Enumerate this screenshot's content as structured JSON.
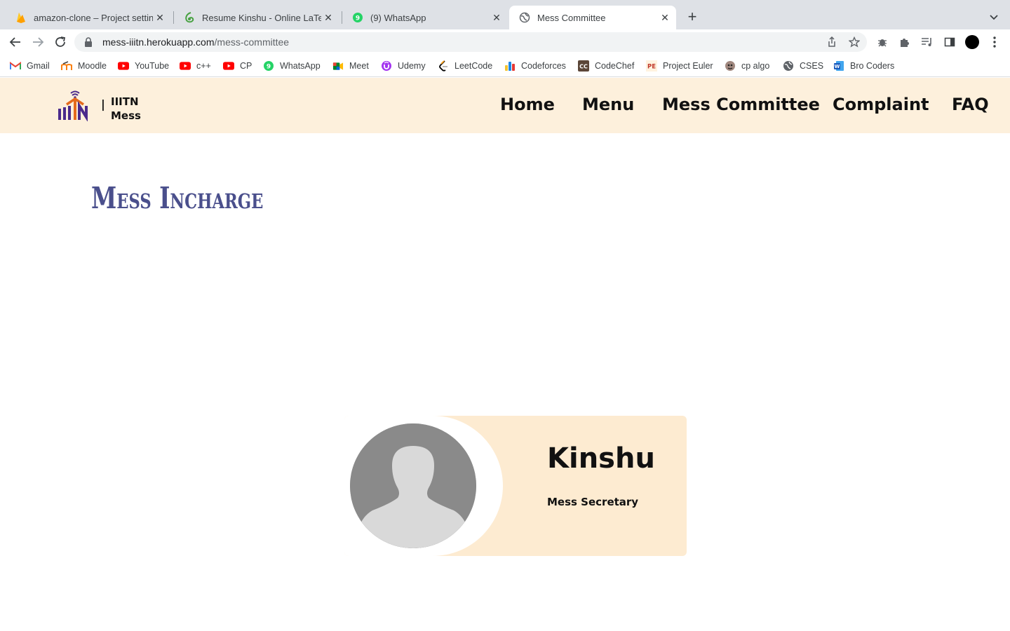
{
  "browser": {
    "tabs": [
      {
        "title": "amazon-clone – Project setting",
        "icon": "firebase-icon"
      },
      {
        "title": "Resume Kinshu - Online LaTeX",
        "icon": "overleaf-icon"
      },
      {
        "title": "(9) WhatsApp",
        "icon": "whatsapp-icon"
      },
      {
        "title": "Mess Committee",
        "icon": "globe-icon"
      }
    ],
    "url_host": "mess-iiitn.herokuapp.com",
    "url_path": "/mess-committee",
    "bookmarks": [
      {
        "label": "Gmail",
        "icon": "gmail-icon"
      },
      {
        "label": "Moodle",
        "icon": "moodle-icon"
      },
      {
        "label": "YouTube",
        "icon": "youtube-icon"
      },
      {
        "label": "c++",
        "icon": "youtube-icon"
      },
      {
        "label": "CP",
        "icon": "youtube-icon"
      },
      {
        "label": "WhatsApp",
        "icon": "whatsapp-icon"
      },
      {
        "label": "Meet",
        "icon": "meet-icon"
      },
      {
        "label": "Udemy",
        "icon": "udemy-icon"
      },
      {
        "label": "LeetCode",
        "icon": "leetcode-icon"
      },
      {
        "label": "Codeforces",
        "icon": "codeforces-icon"
      },
      {
        "label": "CodeChef",
        "icon": "codechef-icon"
      },
      {
        "label": "Project Euler",
        "icon": "project-euler-icon"
      },
      {
        "label": "cp algo",
        "icon": "cp-algo-icon"
      },
      {
        "label": "CSES",
        "icon": "globe-icon"
      },
      {
        "label": "Bro Coders",
        "icon": "word-icon"
      }
    ]
  },
  "site": {
    "brand_separator": "|",
    "brand_line1": "IIITN",
    "brand_line2": "Mess",
    "nav": [
      "Home",
      "Menu",
      "Mess Committee",
      "Complaint",
      "FAQ"
    ]
  },
  "main": {
    "section_title": "Mess Incharge",
    "card": {
      "name": "Kinshu",
      "role": "Mess Secretary"
    }
  },
  "colors": {
    "header_bg": "#fdf0dc",
    "card_bg": "#fdebd1",
    "title_color": "#4a4f8c"
  }
}
